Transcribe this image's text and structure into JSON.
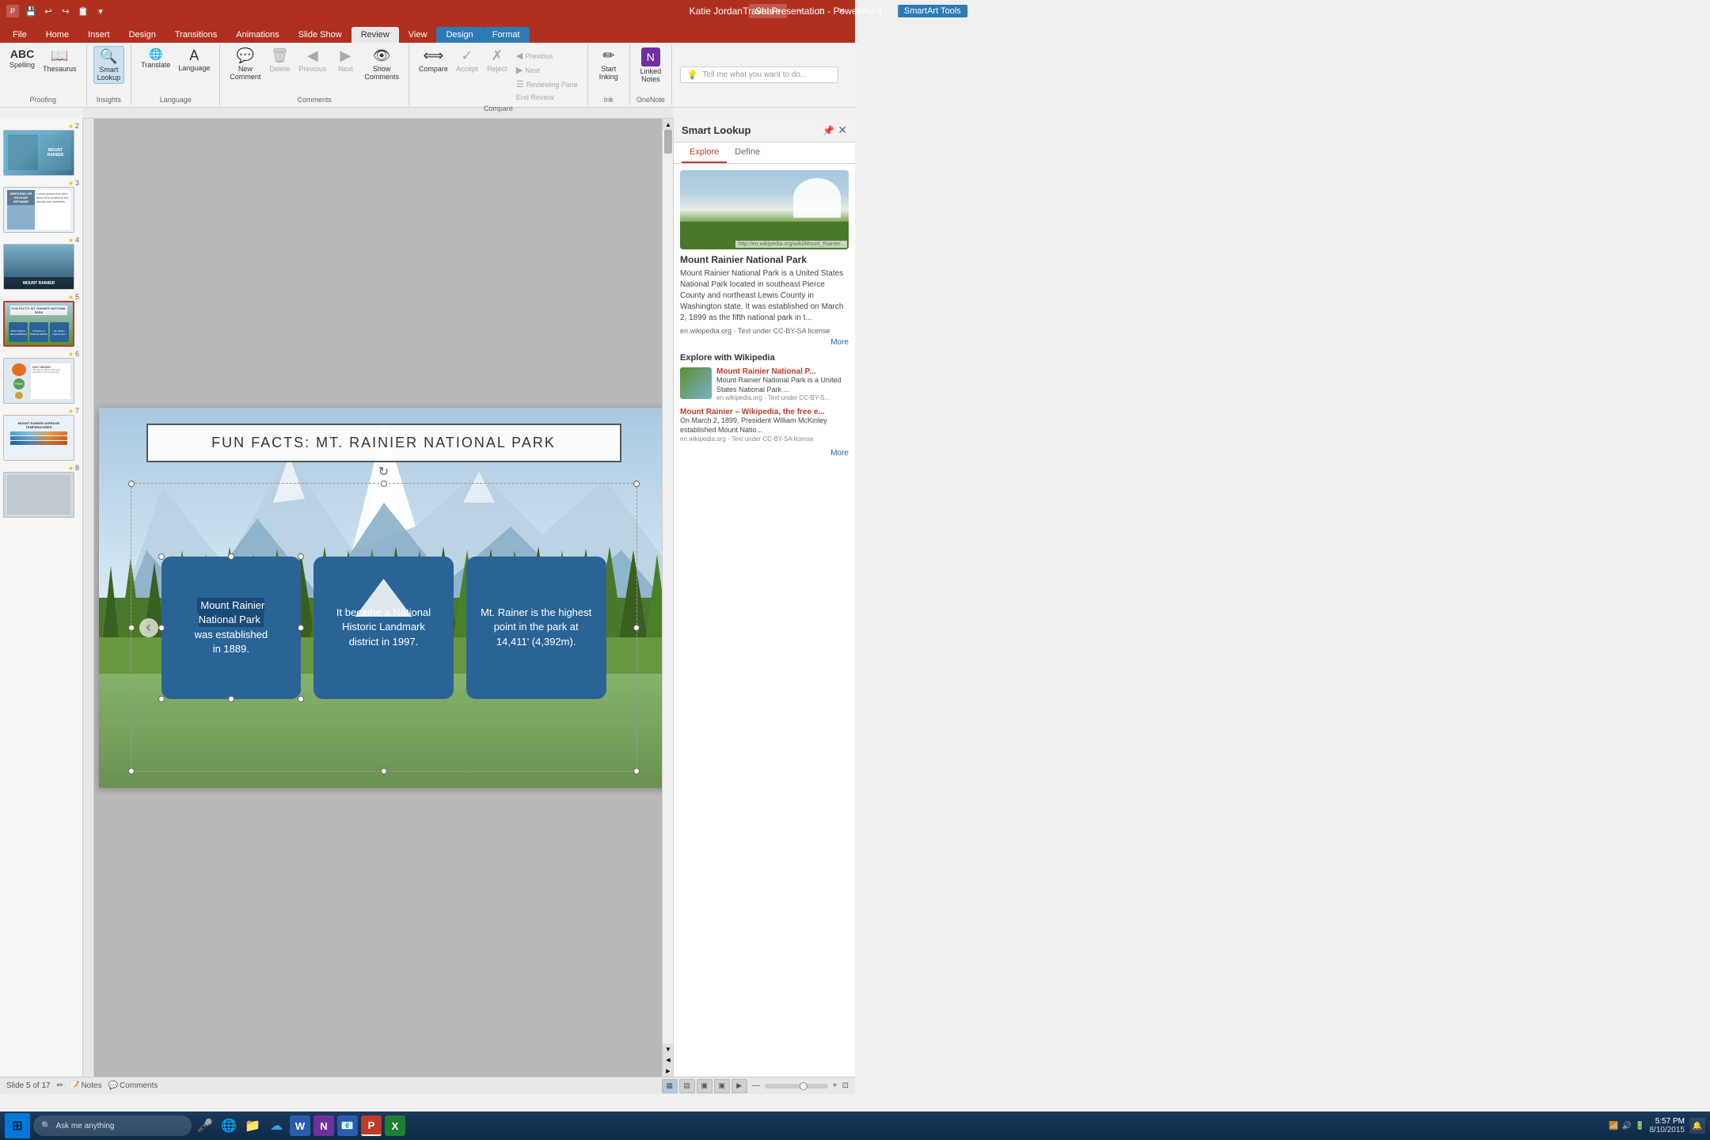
{
  "app": {
    "title": "Travel Presentation - PowerPoint",
    "tools_label": "SmartArt Tools",
    "user": "Katie Jordan",
    "share_label": "Share"
  },
  "qat": {
    "buttons": [
      "💾",
      "↩",
      "↪",
      "📋",
      "▾"
    ]
  },
  "ribbon_tabs": [
    {
      "label": "File",
      "active": false
    },
    {
      "label": "Home",
      "active": false
    },
    {
      "label": "Insert",
      "active": false
    },
    {
      "label": "Design",
      "active": false
    },
    {
      "label": "Transitions",
      "active": false
    },
    {
      "label": "Animations",
      "active": false
    },
    {
      "label": "Slide Show",
      "active": false
    },
    {
      "label": "Review",
      "active": true
    },
    {
      "label": "View",
      "active": false
    },
    {
      "label": "Design",
      "active": false
    },
    {
      "label": "Format",
      "active": false
    }
  ],
  "ribbon_groups": [
    {
      "name": "Proofing",
      "buttons": [
        {
          "icon": "ABC",
          "label": "Spelling",
          "type": "large"
        },
        {
          "icon": "📖",
          "label": "Thesaurus",
          "type": "large"
        }
      ]
    },
    {
      "name": "Insights",
      "buttons": [
        {
          "icon": "🔍",
          "label": "Smart Lookup",
          "type": "large"
        }
      ]
    },
    {
      "name": "Language",
      "buttons": [
        {
          "icon": "🌐",
          "label": "Translate",
          "type": "large"
        },
        {
          "icon": "A",
          "label": "Language",
          "type": "large"
        }
      ]
    },
    {
      "name": "Comments",
      "buttons": [
        {
          "icon": "💬+",
          "label": "New Comment",
          "type": "large"
        },
        {
          "icon": "🗑",
          "label": "Delete",
          "type": "large"
        },
        {
          "icon": "◀",
          "label": "Previous",
          "type": "large"
        },
        {
          "icon": "▶",
          "label": "Next",
          "type": "large"
        },
        {
          "icon": "👁",
          "label": "Show Comments",
          "type": "large"
        }
      ]
    },
    {
      "name": "Compare",
      "buttons": [
        {
          "icon": "⟺",
          "label": "Compare",
          "type": "large"
        },
        {
          "icon": "✓",
          "label": "Accept",
          "type": "large"
        },
        {
          "icon": "✗",
          "label": "Reject",
          "type": "large"
        },
        {
          "icon": "End Review",
          "label": "End Review",
          "type": "small_group"
        }
      ],
      "small_buttons": [
        {
          "icon": "◀",
          "label": "Previous"
        },
        {
          "icon": "▶",
          "label": "Next"
        },
        {
          "icon": "☰",
          "label": "Reviewing Pane"
        }
      ]
    },
    {
      "name": "Ink",
      "buttons": [
        {
          "icon": "✏",
          "label": "Start Inking",
          "type": "large"
        }
      ]
    },
    {
      "name": "OneNote",
      "buttons": [
        {
          "icon": "N",
          "label": "Linked Notes",
          "type": "large"
        }
      ]
    }
  ],
  "slide_panel": {
    "slides": [
      {
        "num": 2,
        "star": true,
        "type": "mountain-scene"
      },
      {
        "num": 3,
        "star": true,
        "type": "weekend-getaway"
      },
      {
        "num": 4,
        "star": true,
        "type": "mount-rainier"
      },
      {
        "num": 5,
        "star": true,
        "type": "fun-facts",
        "active": true
      },
      {
        "num": 6,
        "star": true,
        "type": "trail-vistas"
      },
      {
        "num": 7,
        "star": true,
        "type": "temperatures"
      },
      {
        "num": 8,
        "star": true,
        "type": "other"
      }
    ]
  },
  "main_slide": {
    "title": "FUN FACTS: MT. RAINIER NATIONAL PARK",
    "cards": [
      {
        "highlight": "Mount Rainier National Park",
        "text_before": "",
        "text_after": "was  established in 1889.",
        "full_text": "Mount Rainier National Park was  established in 1889."
      },
      {
        "text": "It became a National Historic Landmark district in 1997."
      },
      {
        "text": "Mt. Rainer is the highest point in the park at 14,411' (4,392m)."
      }
    ],
    "nav_arrow": "‹"
  },
  "smart_lookup": {
    "panel_title": "Smart Lookup",
    "close_btn": "✕",
    "tabs": [
      {
        "label": "Explore",
        "active": true
      },
      {
        "label": "Define",
        "active": false
      }
    ],
    "main_result": {
      "title": "Mount Rainier National Park",
      "description": "Mount Rainier National Park is a United States National Park located in southeast Pierce County and northeast Lewis County in Washington state. It was established on March 2, 1899 as the fifth national park in t...",
      "source": "en.wikipedia.org",
      "license": "Text under CC-BY-SA license",
      "image_label": "http://en.wikipedia.org/wiki/Mount_Rainier..."
    },
    "more_label": "More",
    "explore_section": "Explore with Wikipedia",
    "wiki_items": [
      {
        "title": "Mount Rainier National P...",
        "description": "Mount Rainier National Park is a United States National Park ...",
        "source": "en.wikipedia.org · Text under CC-BY-S..."
      },
      {
        "title": "Mount Rainier – Wikipedia, the free e...",
        "description": "On March 2, 1899, President William McKinley established Mount Natio...",
        "source": "en.wikipedia.org · Text under CC-BY-SA license"
      }
    ],
    "more2_label": "More"
  },
  "status_bar": {
    "slide_info": "Slide 5 of 17",
    "edit_icon": "✏",
    "notes_label": "Notes",
    "comments_label": "Comments",
    "view_buttons": [
      "▦",
      "▤",
      "▣",
      "▣"
    ],
    "zoom_label": "—",
    "zoom_in": "+",
    "zoom_out": "—",
    "zoom_percent": "fit"
  },
  "taskbar": {
    "start_icon": "⊞",
    "search_placeholder": "Ask me anything",
    "mic_icon": "🎤",
    "time": "5:57 PM",
    "date": "8/10/2015",
    "apps": [
      "🌐",
      "📁",
      "☁",
      "W",
      "N",
      "📧",
      "P",
      "X"
    ]
  }
}
